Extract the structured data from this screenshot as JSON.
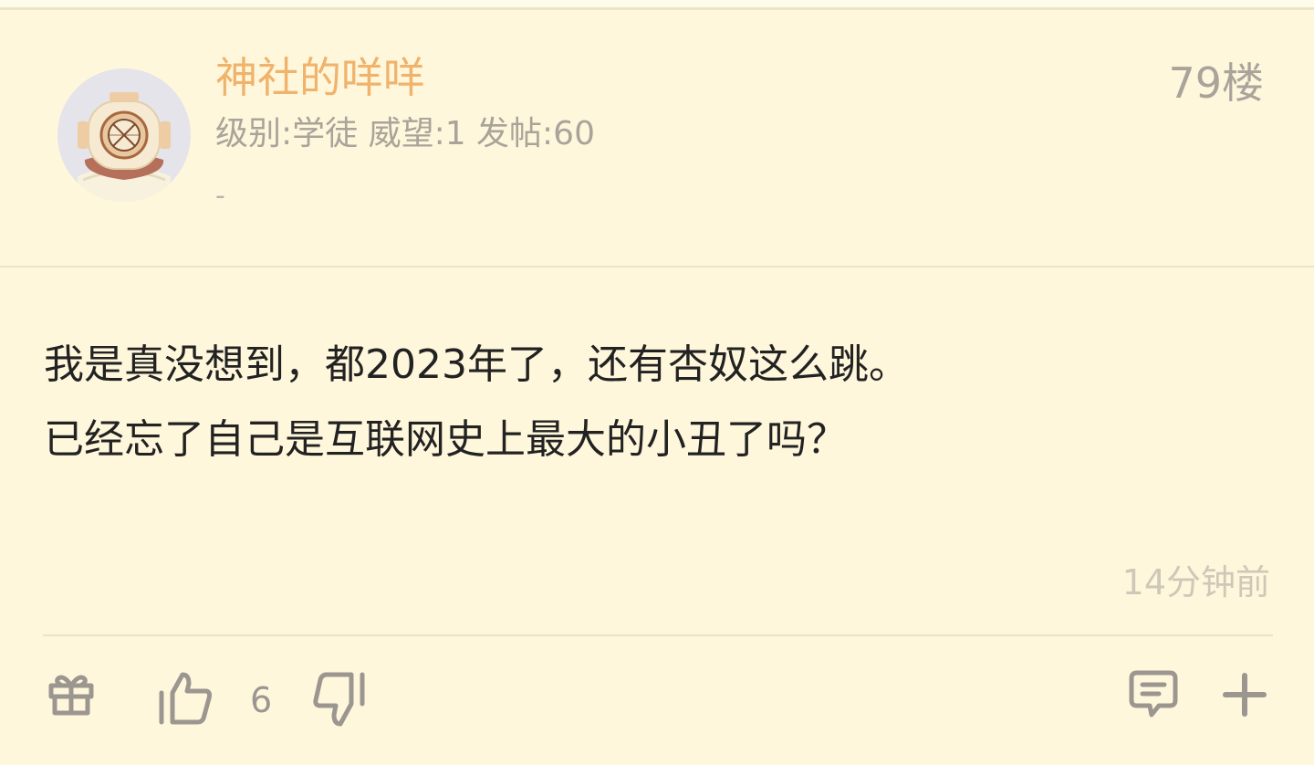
{
  "post": {
    "username": "神社的咩咩",
    "stats": "级别:学徒 威望:1 发帖:60",
    "signature": "-",
    "floor": "79楼",
    "content": {
      "line1": "我是真没想到，都2023年了，还有杏奴这么跳。",
      "line2": "已经忘了自己是互联网史上最大的小丑了吗？"
    },
    "time": "14分钟前",
    "like_count": "6"
  },
  "icons": {
    "avatar": "diving-helmet-avatar",
    "gift": "gift-icon",
    "like": "thumbs-up-icon",
    "dislike": "thumbs-down-icon",
    "comment": "comment-icon",
    "more": "plus-icon"
  },
  "colors": {
    "background": "#fff7dc",
    "username": "#f0b36c",
    "muted_text": "#a9a39a",
    "content_text": "#222222",
    "icon": "#9c9690"
  }
}
